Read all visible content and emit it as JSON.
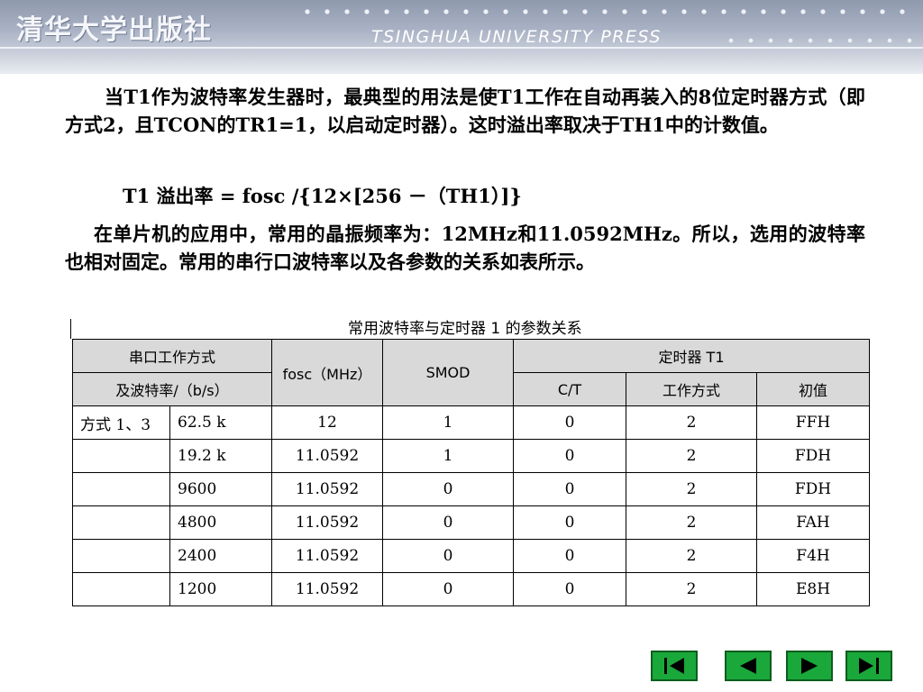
{
  "header": {
    "publisher_cn": "清华大学出版社",
    "publisher_en": "TSINGHUA UNIVERSITY PRESS"
  },
  "body": {
    "paragraph1": "当T1作为波特率发生器时，最典型的用法是使T1工作在自动再装入的8位定时器方式（即方式2，且TCON的TR1=1，以启动定时器）。这时溢出率取决于TH1中的计数值。",
    "formula": "T1 溢出率 = fosc /{12×[256 －（TH1）]}",
    "paragraph2": "在单片机的应用中，常用的晶振频率为：12MHz和11.0592MHz。所以，选用的波特率也相对固定。常用的串行口波特率以及各参数的关系如表所示。"
  },
  "table": {
    "title": "常用波特率与定时器 1 的参数关系",
    "header": {
      "mode_baud_line1": "串口工作方式",
      "mode_baud_line2": "及波特率/（b/s）",
      "fosc": "fosc（MHz）",
      "smod": "SMOD",
      "timer": "定时器 T1",
      "ct": "C/T",
      "work_mode": "工作方式",
      "init_value": "初值"
    },
    "rows": [
      {
        "mode": "方式 1、3",
        "baud": "62.5 k",
        "fosc": "12",
        "smod": "1",
        "ct": "0",
        "work": "2",
        "init": "FFH"
      },
      {
        "mode": "",
        "baud": "19.2 k",
        "fosc": "11.0592",
        "smod": "1",
        "ct": "0",
        "work": "2",
        "init": "FDH"
      },
      {
        "mode": "",
        "baud": "9600",
        "fosc": "11.0592",
        "smod": "0",
        "ct": "0",
        "work": "2",
        "init": "FDH"
      },
      {
        "mode": "",
        "baud": "4800",
        "fosc": "11.0592",
        "smod": "0",
        "ct": "0",
        "work": "2",
        "init": "FAH"
      },
      {
        "mode": "",
        "baud": "2400",
        "fosc": "11.0592",
        "smod": "0",
        "ct": "0",
        "work": "2",
        "init": "F4H"
      },
      {
        "mode": "",
        "baud": "1200",
        "fosc": "11.0592",
        "smod": "0",
        "ct": "0",
        "work": "2",
        "init": "E8H"
      }
    ]
  },
  "nav": {
    "first_icon": "first-page-icon",
    "prev_icon": "prev-page-icon",
    "next_icon": "next-page-icon",
    "last_icon": "last-page-icon",
    "button_color": "#1aa83a"
  }
}
